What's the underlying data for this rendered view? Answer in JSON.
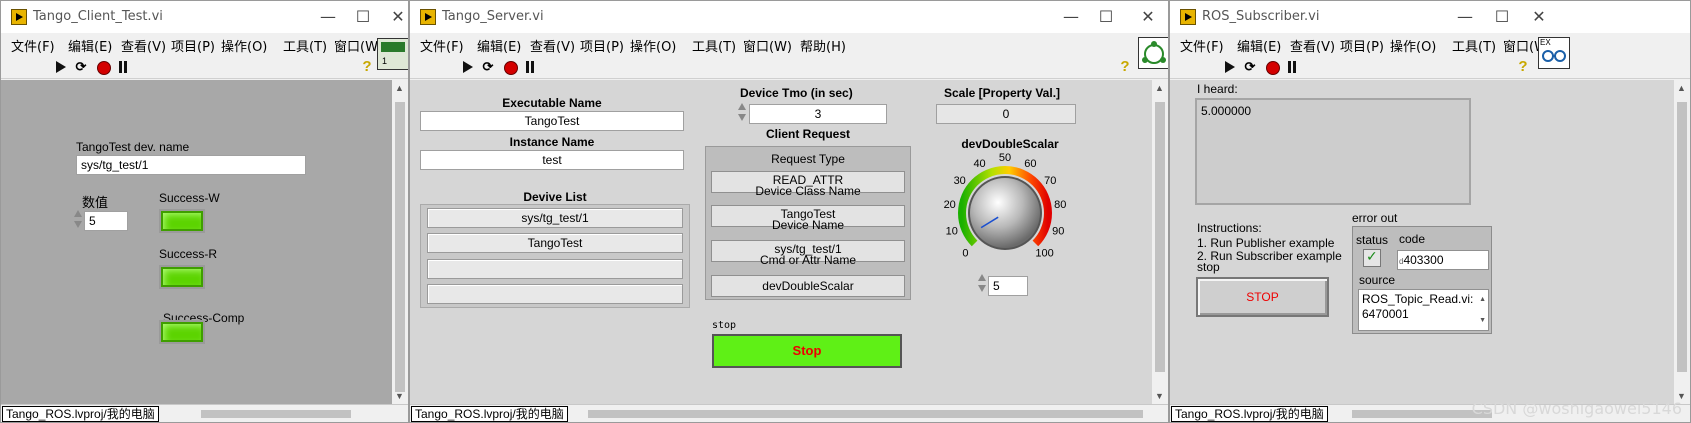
{
  "windows": [
    {
      "title": "Tango_Client_Test.vi",
      "menu": [
        "文件(F)",
        "编辑(E)",
        "查看(V)",
        "项目(P)",
        "操作(O)",
        "工具(T)",
        "窗口(W)"
      ],
      "status": "Tango_ROS.lvproj/我的电脑"
    },
    {
      "title": "Tango_Server.vi",
      "menu": [
        "文件(F)",
        "编辑(E)",
        "查看(V)",
        "项目(P)",
        "操作(O)",
        "工具(T)",
        "窗口(W)",
        "帮助(H)"
      ],
      "status": "Tango_ROS.lvproj/我的电脑"
    },
    {
      "title": "ROS_Subscriber.vi",
      "menu": [
        "文件(F)",
        "编辑(E)",
        "查看(V)",
        "项目(P)",
        "操作(O)",
        "工具(T)",
        "窗口(W)"
      ],
      "status": "Tango_ROS.lvproj/我的电脑"
    }
  ],
  "window_controls": {
    "minimize": "—",
    "maximize": "☐",
    "close": "✕"
  },
  "client": {
    "dev_name_label": "TangoTest dev. name",
    "dev_name_value": "sys/tg_test/1",
    "num_label": "数值",
    "num_value": "5",
    "led_labels": [
      "Success-W",
      "Success-R",
      "Success-Comp"
    ],
    "icon_text": "1"
  },
  "server": {
    "exec_name_label": "Executable Name",
    "exec_name_value": "TangoTest",
    "instance_name_label": "Instance Name",
    "instance_name_value": "test",
    "device_list_label": "Devive List",
    "device_list": [
      "sys/tg_test/1",
      "TangoTest",
      "",
      ""
    ],
    "tmo_label": "Device Tmo (in sec)",
    "tmo_value": "3",
    "client_request_label": "Client Request",
    "request_rows": [
      {
        "label": "Request Type",
        "value": "READ_ATTR"
      },
      {
        "label": "Device Class Name",
        "value": "TangoTest"
      },
      {
        "label": "Device Name",
        "value": "sys/tg_test/1"
      },
      {
        "label": "Cmd or Attr Name",
        "value": "devDoubleScalar"
      }
    ],
    "scale_label": "Scale  [Property Val.]",
    "scale_value": "0",
    "knob_label": "devDoubleScalar",
    "knob_ticks": [
      "0",
      "10",
      "20",
      "30",
      "40",
      "50",
      "60",
      "70",
      "80",
      "90",
      "100"
    ],
    "knob_value": 5,
    "knob_value_text": "5",
    "stop_small_label": "stop",
    "stop_button": "Stop"
  },
  "subscriber": {
    "heard_label": "I heard:",
    "heard_value": "5.000000",
    "instructions_title": "Instructions:",
    "instructions": [
      "1. Run Publisher example",
      "2. Run Subscriber example stop"
    ],
    "stop_button": "STOP",
    "error_out_label": "error out",
    "status_label": "status",
    "code_label": "code",
    "code_prefix": "d",
    "code_value": "403300",
    "source_label": "source",
    "source_value": "ROS_Topic_Read.vi: 6470001",
    "icon_text": "EX"
  },
  "watermark": "CSDN @woshigaowei5146",
  "colors": {
    "led_green": "#5cd400",
    "stop_green": "#5ff016",
    "stop_text": "#e00000",
    "panel_gray": "#d6d6d6"
  }
}
